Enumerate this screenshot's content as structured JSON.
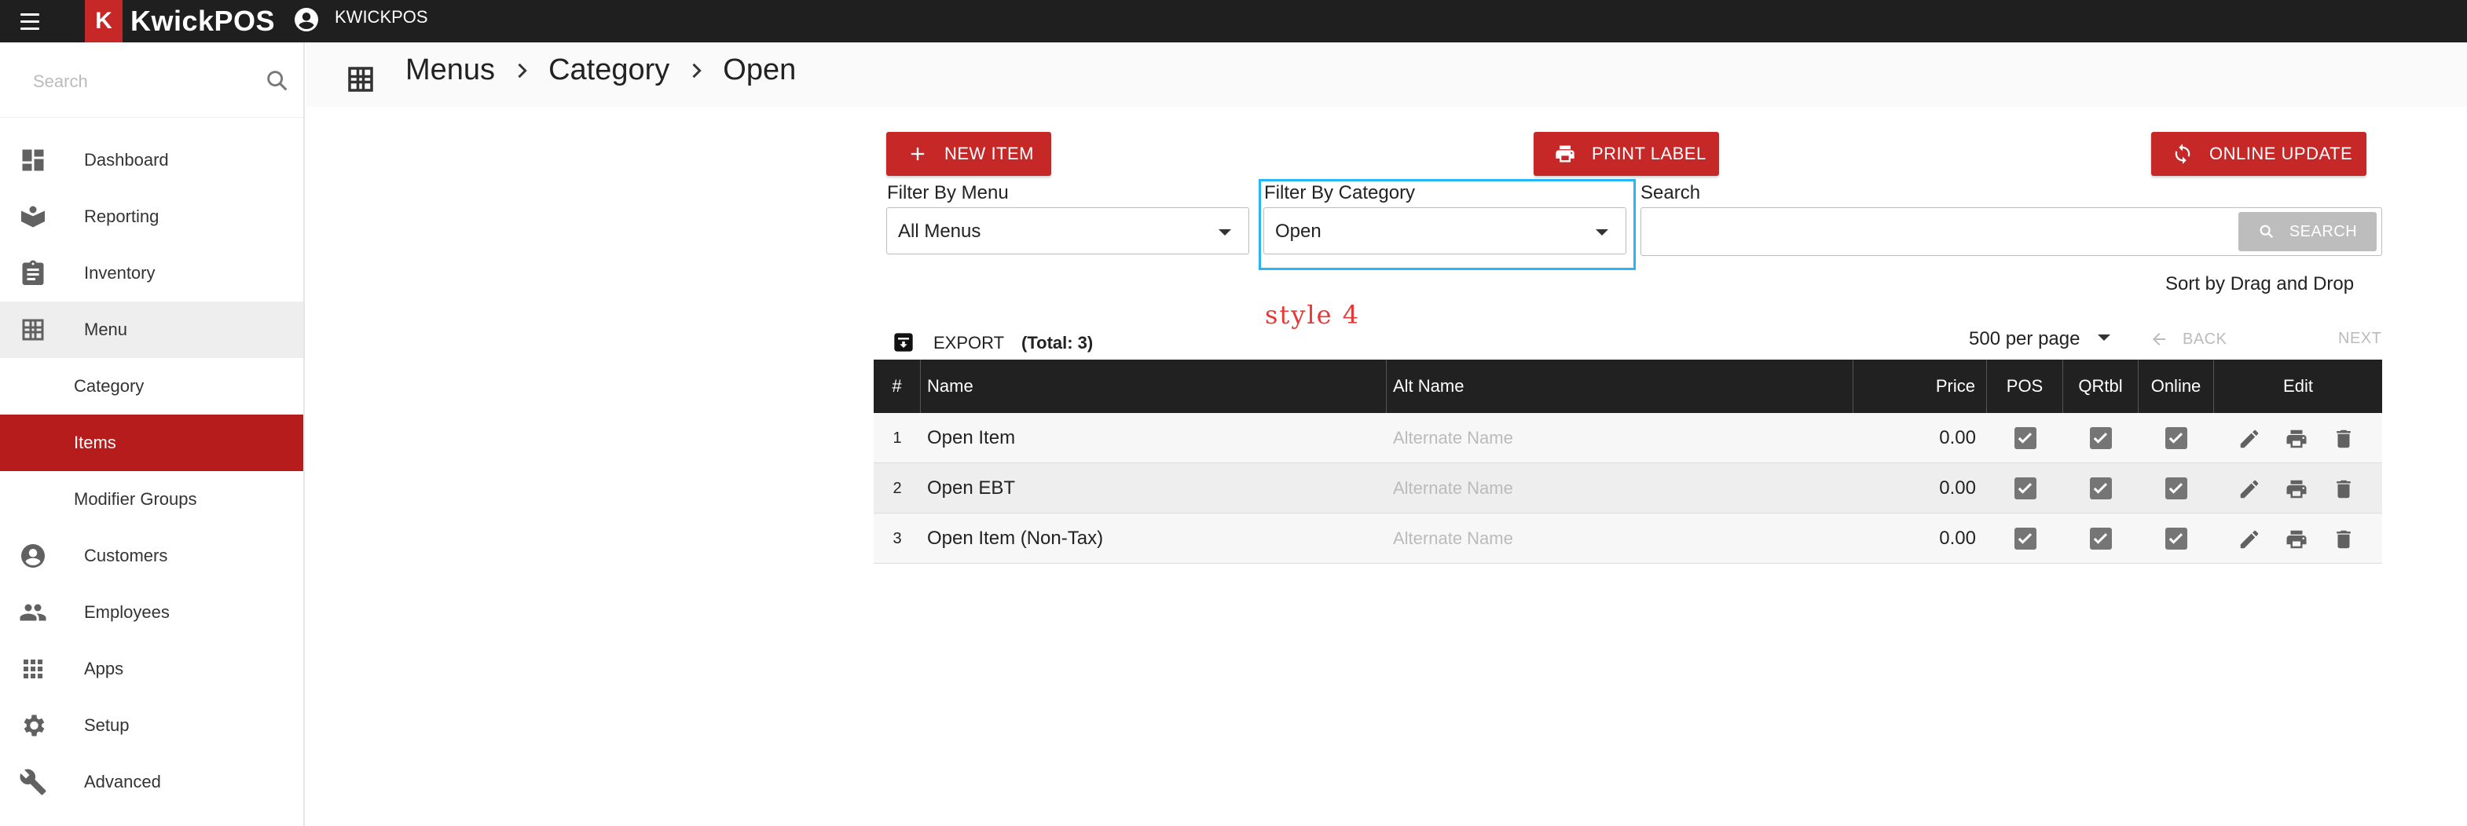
{
  "topbar": {
    "logo_mark": "K",
    "logo_text": "KwickPOS",
    "store_name": "KWICKPOS"
  },
  "sidebar": {
    "search_placeholder": "Search",
    "items": [
      {
        "label": "Dashboard",
        "icon": "dashboard-icon"
      },
      {
        "label": "Reporting",
        "icon": "reporting-icon"
      },
      {
        "label": "Inventory",
        "icon": "inventory-icon"
      },
      {
        "label": "Menu",
        "icon": "menu-grid-icon"
      },
      {
        "label": "Category"
      },
      {
        "label": "Items"
      },
      {
        "label": "Modifier Groups"
      },
      {
        "label": "Customers",
        "icon": "account-circle-icon"
      },
      {
        "label": "Employees",
        "icon": "people-icon"
      },
      {
        "label": "Apps",
        "icon": "apps-icon"
      },
      {
        "label": "Setup",
        "icon": "gear-icon"
      },
      {
        "label": "Advanced",
        "icon": "wrench-icon"
      }
    ]
  },
  "header": {
    "breadcrumb": [
      "Menus",
      "Category",
      "Open"
    ]
  },
  "toolbar": {
    "new_item": "NEW ITEM",
    "print_label": "PRINT LABEL",
    "online_update": "ONLINE UPDATE"
  },
  "filters": {
    "menu_label": "Filter By Menu",
    "menu_value": "All Menus",
    "category_label": "Filter By Category",
    "category_value": "Open",
    "search_label": "Search",
    "search_value": "",
    "search_button": "SEARCH"
  },
  "sort_text": "Sort by Drag and Drop",
  "annotation": "style 4",
  "list": {
    "export": "EXPORT",
    "total": "(Total: 3)",
    "per_page": "500 per page",
    "back": "BACK",
    "next": "NEXT"
  },
  "table": {
    "headers": [
      "#",
      "Name",
      "Alt Name",
      "Price",
      "POS",
      "QRtbl",
      "Online",
      "Edit"
    ],
    "alt_placeholder": "Alternate Name",
    "rows": [
      {
        "num": "1",
        "name": "Open Item",
        "price": "0.00",
        "pos": true,
        "qrtbl": true,
        "online": true
      },
      {
        "num": "2",
        "name": "Open EBT",
        "price": "0.00",
        "pos": true,
        "qrtbl": true,
        "online": true
      },
      {
        "num": "3",
        "name": "Open Item (Non-Tax)",
        "price": "0.00",
        "pos": true,
        "qrtbl": true,
        "online": true
      }
    ]
  },
  "colors": {
    "brand_red": "#c62828",
    "selected_red": "#b71c1c",
    "highlight_blue": "#29b6f6",
    "topbar": "#1f1f1f"
  }
}
